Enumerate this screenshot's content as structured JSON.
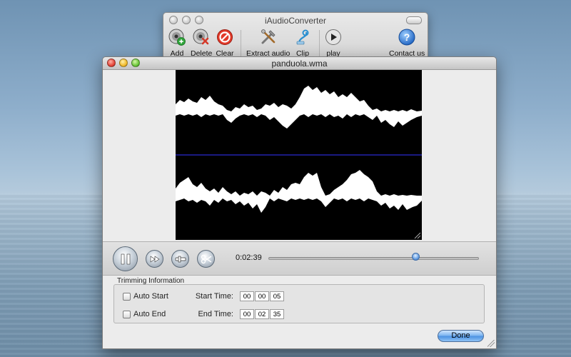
{
  "main_window": {
    "title": "iAudioConverter",
    "toolbar": [
      {
        "id": "add",
        "label": "Add",
        "icon": "add-disc-icon"
      },
      {
        "id": "delete",
        "label": "Delete",
        "icon": "delete-disc-icon"
      },
      {
        "id": "clear",
        "label": "Clear",
        "icon": "clear-icon"
      },
      {
        "id": "extract",
        "label": "Extract audio",
        "icon": "tools-icon"
      },
      {
        "id": "clip",
        "label": "Clip",
        "icon": "clip-icon"
      },
      {
        "id": "play",
        "label": "play",
        "icon": "play-icon"
      },
      {
        "id": "contact",
        "label": "Contact us",
        "icon": "help-icon"
      }
    ]
  },
  "doc_window": {
    "title": "panduola.wma"
  },
  "transport": {
    "current_time": "0:02:39",
    "progress": 0.7
  },
  "trimming": {
    "section_label": "Trimming Information",
    "auto_start_label": "Auto Start",
    "auto_end_label": "Auto End",
    "auto_start_checked": false,
    "auto_end_checked": false,
    "start_time_label": "Start Time:",
    "end_time_label": "End Time:",
    "start_time": {
      "h": "00",
      "m": "00",
      "s": "05"
    },
    "end_time": {
      "h": "00",
      "m": "02",
      "s": "35"
    }
  },
  "buttons": {
    "done_label": "Done"
  },
  "colors": {
    "waveform_fill": "#ffffff",
    "waveform_bg": "#000000",
    "channel_divider": "#2b2bd0",
    "done_button": "#5b9ee8"
  }
}
